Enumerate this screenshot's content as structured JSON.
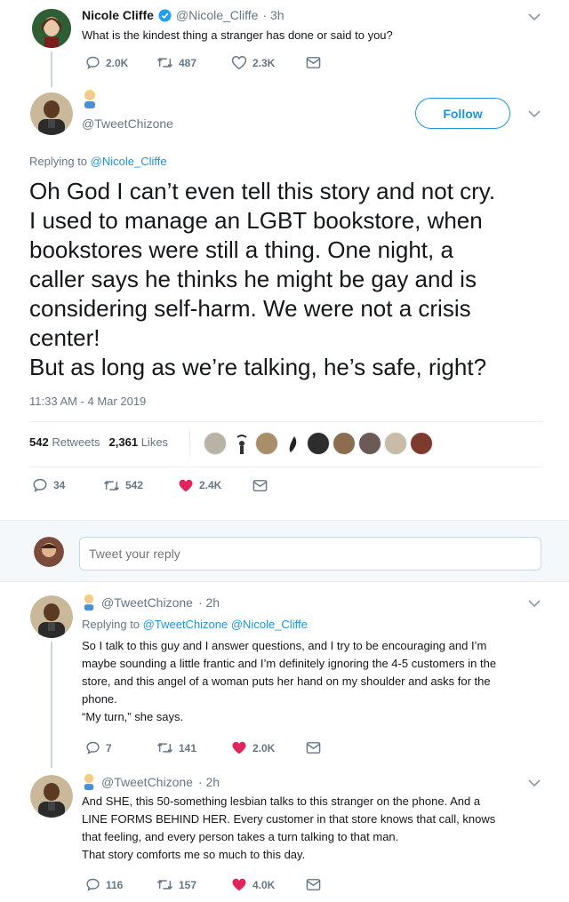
{
  "colors": {
    "accent": "#1b95e0",
    "verified": "#1da1f2",
    "like_red": "#e0245e",
    "muted": "#657786",
    "divider": "#e6ecf0"
  },
  "tweet1": {
    "name": "Nicole Cliffe",
    "handle": "@Nicole_Cliffe",
    "time": "· 3h",
    "text": "What is the kindest thing a stranger has done or said to you?",
    "replies": "2.0K",
    "retweets": "487",
    "likes": "2.3K"
  },
  "main": {
    "handle": "@TweetChizone",
    "follow_label": "Follow",
    "replying_prefix": "Replying to",
    "replying_to": "@Nicole_Cliffe",
    "text_lines": [
      "Oh God I can’t even tell this story and not cry.",
      "I used to manage an LGBT bookstore, when",
      "bookstores were still a thing. One night, a",
      "caller says he thinks he might be gay and is",
      "considering self-harm. We were not a crisis",
      "center!",
      "But as long as we’re talking, he’s safe, right?"
    ],
    "timestamp": "11:33 AM - 4 Mar 2019",
    "retweet_count": "542",
    "retweet_label": "Retweets",
    "like_count": "2,361",
    "like_label": "Likes",
    "replies": "34",
    "retweets": "542",
    "likes": "2.4K"
  },
  "reply_box": {
    "placeholder": "Tweet your reply"
  },
  "reply1": {
    "handle": "@TweetChizone",
    "time": "· 2h",
    "replying_prefix": "Replying to",
    "replying_to": "@TweetChizone @Nicole_Cliffe",
    "lines": [
      "So I talk to this guy and I answer questions, and I try to be encouraging and I’m",
      "maybe sounding a little frantic and I’m definitely ignoring the 4-5 customers in the",
      "store, and this angel of a woman puts her hand on my shoulder and asks for the",
      "phone.",
      "“My turn,” she says."
    ],
    "replies": "7",
    "retweets": "141",
    "likes": "2.0K"
  },
  "reply2": {
    "handle": "@TweetChizone",
    "time": "· 2h",
    "lines": [
      "And SHE, this 50-something lesbian talks to this stranger on the phone. And a",
      "LINE FORMS BEHIND HER. Every customer in that store knows that call, knows",
      "that feeling, and every person takes a turn talking to that man.",
      "That story comforts me so much to this day."
    ],
    "replies": "116",
    "retweets": "157",
    "likes": "4.0K"
  }
}
